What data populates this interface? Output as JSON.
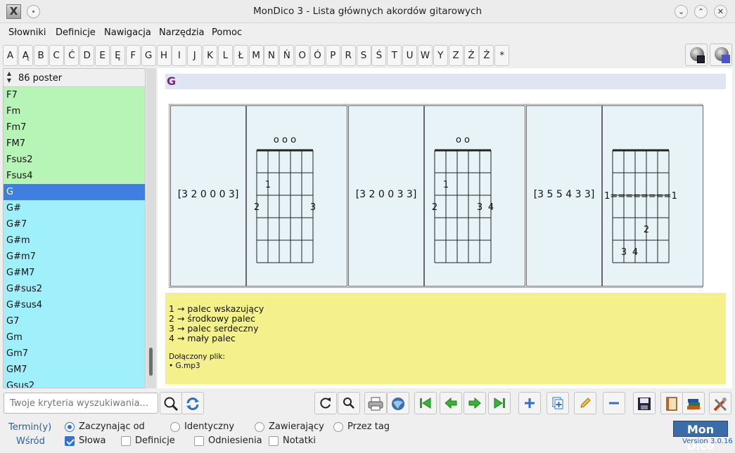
{
  "window": {
    "title": "MonDico 3 - Lista głównych akordów gitarowych",
    "app_icon_glyph": "X",
    "controls": [
      "⌄",
      "⌃",
      "✕"
    ]
  },
  "menu": [
    "Słowniki",
    "Definicje",
    "Nawigacja",
    "Narzędzia",
    "Pomoc"
  ],
  "alphabet": [
    "A",
    "Ą",
    "B",
    "C",
    "Ć",
    "D",
    "E",
    "Ę",
    "F",
    "G",
    "H",
    "I",
    "J",
    "K",
    "L",
    "Ł",
    "M",
    "N",
    "Ń",
    "O",
    "Ó",
    "P",
    "R",
    "S",
    "Ś",
    "T",
    "U",
    "W",
    "Y",
    "Z",
    "Ź",
    "Ż",
    "*"
  ],
  "sidebar": {
    "count_label": "86 poster",
    "items": [
      {
        "label": "F7",
        "color": "#b7f5b7"
      },
      {
        "label": "Fm",
        "color": "#b7f5b7"
      },
      {
        "label": "Fm7",
        "color": "#b7f5b7"
      },
      {
        "label": "FM7",
        "color": "#b7f5b7"
      },
      {
        "label": "Fsus2",
        "color": "#b7f5b7"
      },
      {
        "label": "Fsus4",
        "color": "#b7f5b7"
      },
      {
        "label": "G",
        "color": "#3f7fdf",
        "selected": true
      },
      {
        "label": "G#",
        "color": "#9ff0fb"
      },
      {
        "label": "G#7",
        "color": "#9ff0fb"
      },
      {
        "label": "G#m",
        "color": "#9ff0fb"
      },
      {
        "label": "G#m7",
        "color": "#9ff0fb"
      },
      {
        "label": "G#M7",
        "color": "#9ff0fb"
      },
      {
        "label": "G#sus2",
        "color": "#9ff0fb"
      },
      {
        "label": "G#sus4",
        "color": "#9ff0fb"
      },
      {
        "label": "G7",
        "color": "#9ff0fb"
      },
      {
        "label": "Gm",
        "color": "#9ff0fb"
      },
      {
        "label": "Gm7",
        "color": "#9ff0fb"
      },
      {
        "label": "GM7",
        "color": "#9ff0fb"
      },
      {
        "label": "Gsus2",
        "color": "#9ff0fb"
      }
    ]
  },
  "content": {
    "title": "G",
    "chords": [
      {
        "frets_label": "[3 2 0 0 0 3]",
        "open_marks": "o o o",
        "fingers": [
          {
            "text": "1",
            "string": 2,
            "fret": 2
          },
          {
            "text": "2",
            "string": 1,
            "fret": 3
          },
          {
            "text": "3",
            "string": 6,
            "fret": 3
          }
        ]
      },
      {
        "frets_label": "[3 2 0 0 3 3]",
        "open_marks": "o o",
        "fingers": [
          {
            "text": "1",
            "string": 2,
            "fret": 2
          },
          {
            "text": "2",
            "string": 1,
            "fret": 3
          },
          {
            "text": "3",
            "string": 5,
            "fret": 3
          },
          {
            "text": "4",
            "string": 6,
            "fret": 3
          }
        ]
      },
      {
        "frets_label": "[3 5 5 4 3 3]",
        "open_marks": "",
        "barre_text": "1========1",
        "fingers": [
          {
            "text": "2",
            "string": 4,
            "fret": 4
          },
          {
            "text": "3",
            "string": 2,
            "fret": 5
          },
          {
            "text": "4",
            "string": 3,
            "fret": 5
          }
        ]
      }
    ],
    "legend": {
      "lines": [
        "1 → palec wskazujący",
        "2 → środkowy palec",
        "3 → palec serdeczny",
        "4 → mały palec"
      ],
      "attached_label": "Dołączony plik:",
      "attached_file": "• G.mp3"
    }
  },
  "toolbar": {
    "search_placeholder": "Twoje kryteria wyszukiwania..."
  },
  "filters": {
    "terms_label": "Termin(y)",
    "among_label": "Wśród",
    "match_options": [
      {
        "label": "Zaczynając od",
        "checked": true
      },
      {
        "label": "Identyczny",
        "checked": false
      },
      {
        "label": "Zawierający",
        "checked": false
      },
      {
        "label": "Przez tag",
        "checked": false
      }
    ],
    "scope_options": [
      {
        "label": "Słowa",
        "checked": true
      },
      {
        "label": "Definicje",
        "checked": false
      },
      {
        "label": "Odniesienia",
        "checked": false
      },
      {
        "label": "Notatki",
        "checked": false
      }
    ]
  },
  "brand": {
    "logo": "Mon Dico",
    "version": "Version 3.0.16"
  }
}
